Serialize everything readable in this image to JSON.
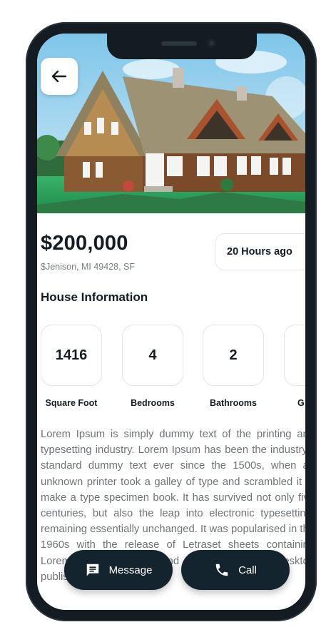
{
  "listing": {
    "price": "$200,000",
    "address": "$Jenison, MI 49428, SF",
    "posted": "20 Hours ago"
  },
  "section_title": "House Information",
  "stats": [
    {
      "value": "1416",
      "label": "Square Foot"
    },
    {
      "value": "4",
      "label": "Bedrooms"
    },
    {
      "value": "2",
      "label": "Bathrooms"
    },
    {
      "value": "",
      "label": "G"
    }
  ],
  "description": "Lorem Ipsum is simply dummy text of the printing and typesetting industry. Lorem Ipsum has been the industry's standard dummy text ever since the 1500s, when an unknown printer took a galley of type and scrambled it to make a type specimen book. It has survived not only five centuries, but also the leap into electronic typesetting, remaining essentially unchanged. It was popularised in the 1960s with the release of Letraset sheets containing Lorem Ipsum passages, and more recently with desktop publishing",
  "actions": {
    "message_label": "Message",
    "call_label": "Call"
  },
  "icons": {
    "back": "arrow-left-icon",
    "message": "chat-bubble-icon",
    "call": "phone-icon"
  },
  "colors": {
    "primary_dark": "#14242e",
    "text": "#141c22",
    "muted": "#7b7f83",
    "border": "#e3e5e7"
  }
}
